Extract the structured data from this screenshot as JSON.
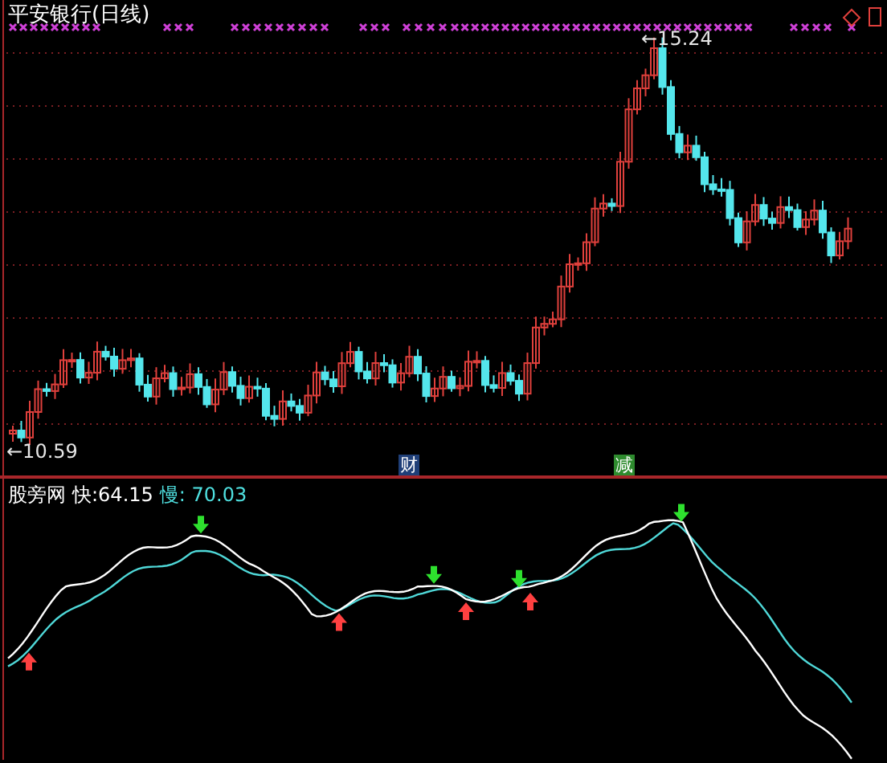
{
  "chart_title": "平安银行(日线)",
  "price_labels": [
    {
      "kind": "high",
      "text": "←15.24"
    },
    {
      "kind": "low",
      "text": "←10.59"
    }
  ],
  "event_badges": [
    {
      "text": "财",
      "color": "#1f3f78"
    },
    {
      "text": "减",
      "color": "#2e8b2e"
    }
  ],
  "indicator": {
    "name": "股旁网",
    "fast_label": "快:",
    "fast_value": "64.15",
    "slow_label": "慢:",
    "slow_value": "70.03"
  }
}
